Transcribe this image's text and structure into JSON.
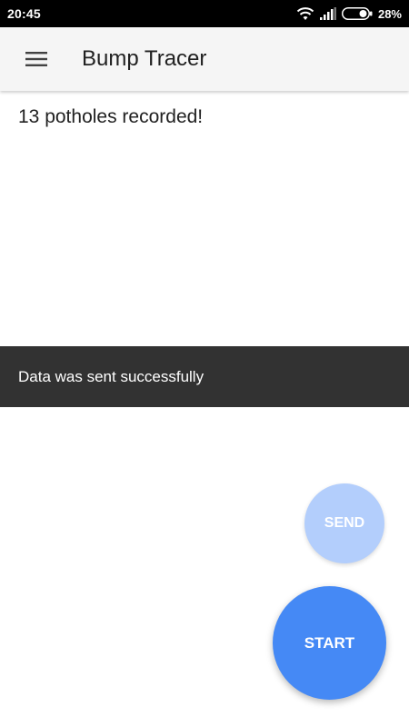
{
  "status_bar": {
    "time": "20:45",
    "battery_percent": "28%",
    "icons": [
      "wifi-icon",
      "signal-icon",
      "battery-icon"
    ]
  },
  "app_bar": {
    "title": "Bump Tracer",
    "menu_icon": "menu-icon"
  },
  "main": {
    "status_message": "13 potholes recorded!"
  },
  "snackbar": {
    "message": "Data was sent successfully"
  },
  "buttons": {
    "send_label": "SEND",
    "start_label": "START"
  },
  "colors": {
    "accent": "#4589f5",
    "accent_disabled": "#b3cefc",
    "snackbar": "#323232",
    "app_bar": "#f5f5f5"
  }
}
